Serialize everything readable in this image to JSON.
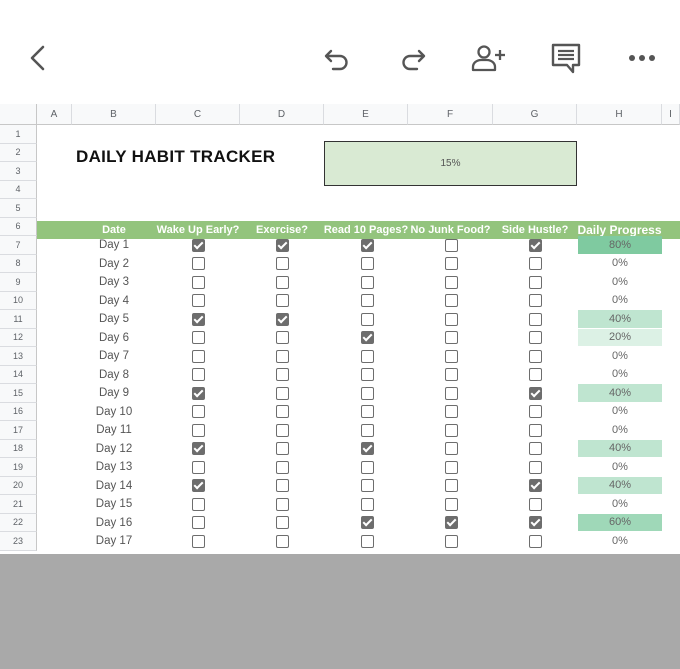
{
  "toolbar": {
    "back_icon": "back-arrow-icon",
    "undo_icon": "undo-icon",
    "redo_icon": "redo-icon",
    "share_icon": "add-person-icon",
    "comment_icon": "comment-icon",
    "more_icon": "more-horizontal-icon"
  },
  "sheet": {
    "columns": [
      "A",
      "B",
      "C",
      "D",
      "E",
      "F",
      "G",
      "H",
      "I"
    ],
    "rows": [
      "1",
      "2",
      "3",
      "4",
      "5",
      "6",
      "7",
      "8",
      "9",
      "10",
      "11",
      "12",
      "13",
      "14",
      "15",
      "16",
      "17",
      "18",
      "19",
      "20",
      "21",
      "22",
      "23"
    ],
    "title": "DAILY HABIT TRACKER",
    "overall_progress": "15%",
    "headers": [
      "Date",
      "Wake Up Early?",
      "Exercise?",
      "Read 10 Pages?",
      "No Junk Food?",
      "Side Hustle?",
      "Daily Progress"
    ],
    "days": [
      {
        "date": "Day 1",
        "checks": [
          true,
          true,
          true,
          false,
          true
        ],
        "progress": "80%"
      },
      {
        "date": "Day 2",
        "checks": [
          false,
          false,
          false,
          false,
          false
        ],
        "progress": "0%"
      },
      {
        "date": "Day 3",
        "checks": [
          false,
          false,
          false,
          false,
          false
        ],
        "progress": "0%"
      },
      {
        "date": "Day 4",
        "checks": [
          false,
          false,
          false,
          false,
          false
        ],
        "progress": "0%"
      },
      {
        "date": "Day 5",
        "checks": [
          true,
          true,
          false,
          false,
          false
        ],
        "progress": "40%"
      },
      {
        "date": "Day 6",
        "checks": [
          false,
          false,
          true,
          false,
          false
        ],
        "progress": "20%"
      },
      {
        "date": "Day 7",
        "checks": [
          false,
          false,
          false,
          false,
          false
        ],
        "progress": "0%"
      },
      {
        "date": "Day 8",
        "checks": [
          false,
          false,
          false,
          false,
          false
        ],
        "progress": "0%"
      },
      {
        "date": "Day 9",
        "checks": [
          true,
          false,
          false,
          false,
          true
        ],
        "progress": "40%"
      },
      {
        "date": "Day 10",
        "checks": [
          false,
          false,
          false,
          false,
          false
        ],
        "progress": "0%"
      },
      {
        "date": "Day 11",
        "checks": [
          false,
          false,
          false,
          false,
          false
        ],
        "progress": "0%"
      },
      {
        "date": "Day 12",
        "checks": [
          true,
          false,
          true,
          false,
          false
        ],
        "progress": "40%"
      },
      {
        "date": "Day 13",
        "checks": [
          false,
          false,
          false,
          false,
          false
        ],
        "progress": "0%"
      },
      {
        "date": "Day 14",
        "checks": [
          true,
          false,
          false,
          false,
          true
        ],
        "progress": "40%"
      },
      {
        "date": "Day 15",
        "checks": [
          false,
          false,
          false,
          false,
          false
        ],
        "progress": "0%"
      },
      {
        "date": "Day 16",
        "checks": [
          false,
          false,
          true,
          true,
          true
        ],
        "progress": "60%"
      },
      {
        "date": "Day 17",
        "checks": [
          false,
          false,
          false,
          false,
          false
        ],
        "progress": "0%"
      }
    ]
  },
  "colors": {
    "header_green": "#93c47d",
    "overall_fill": "#d9ead3",
    "progress_80": "#7fcaa0",
    "progress_60": "#9fd8b8",
    "progress_40": "#bfe5d0",
    "progress_20": "#dcf1e5",
    "bottom_gray": "#a9a9a9"
  }
}
